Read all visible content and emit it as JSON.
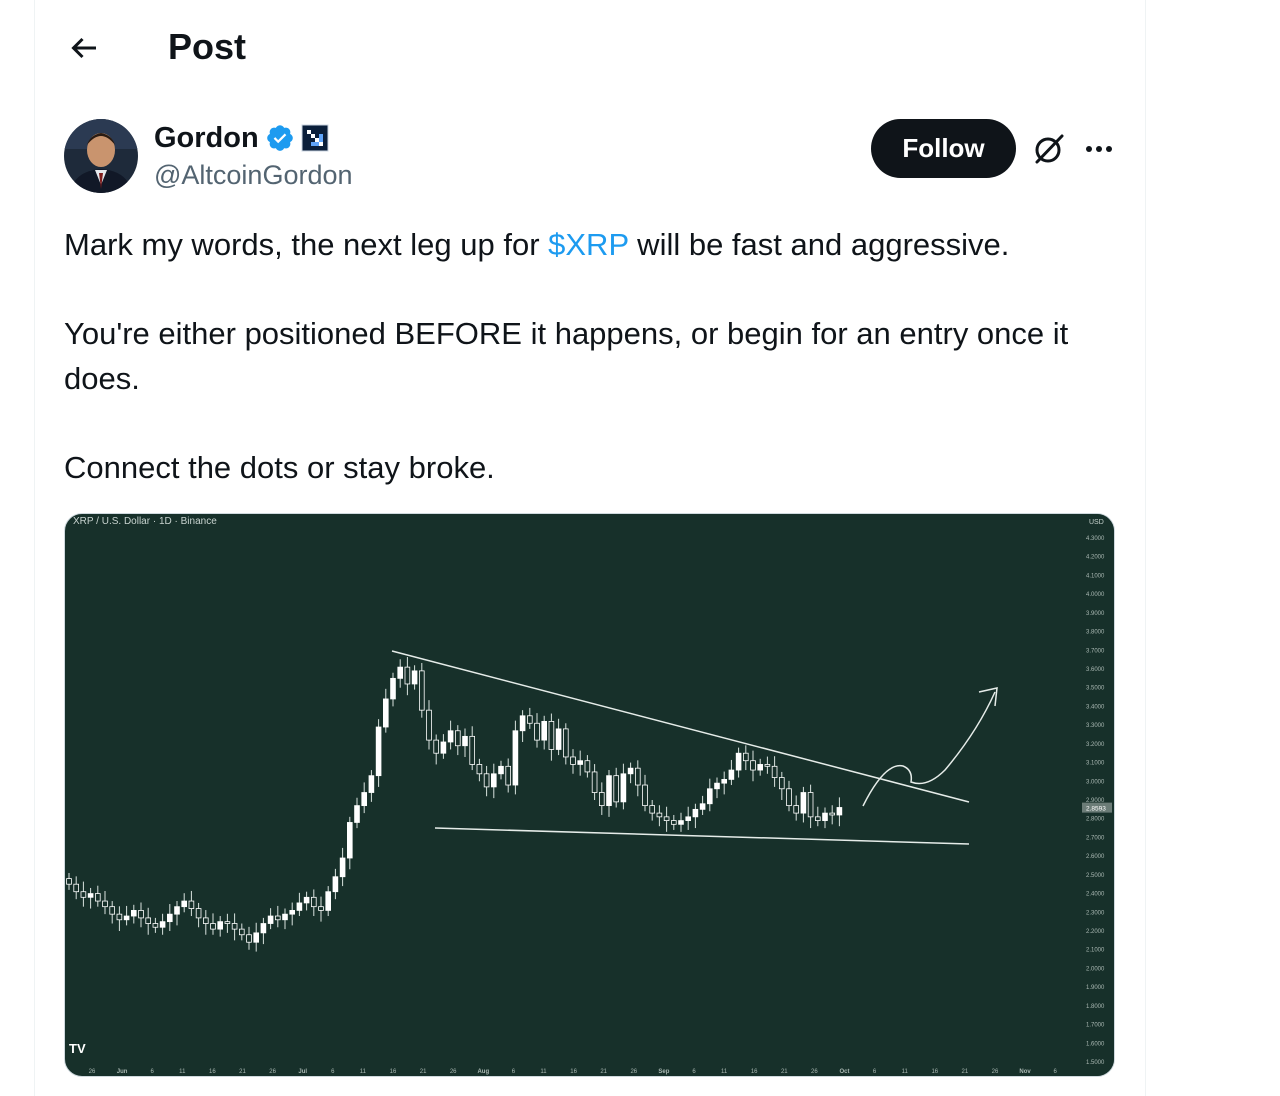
{
  "header": {
    "title": "Post"
  },
  "author": {
    "name": "Gordon",
    "handle": "@AltcoinGordon"
  },
  "actions": {
    "follow_label": "Follow"
  },
  "tweet": {
    "p1_before": "Mark my words, the next leg up for ",
    "p1_link": "$XRP",
    "p1_after": " will be fast and aggressive.",
    "p2": "You're either positioned BEFORE it happens, or begin for an entry once it does.",
    "p3": "Connect the dots or stay broke."
  },
  "colors": {
    "accent": "#1d9bf0",
    "chart_bg": "#17302a",
    "follow_bg": "#0f1419",
    "candle_up": "#ffffff"
  },
  "icons": [
    "back-arrow-icon",
    "verified-badge-icon",
    "affiliate-icon",
    "grok-icon",
    "more-icon"
  ],
  "chart_data": {
    "type": "candlestick",
    "title": "XRP / U.S. Dollar · 1D · Binance",
    "currency_label": "USD",
    "current_price_label": "2.8593",
    "y_ticks": [
      "4.3000",
      "4.2000",
      "4.1000",
      "4.0000",
      "3.9000",
      "3.8000",
      "3.7000",
      "3.6000",
      "3.5000",
      "3.4000",
      "3.3000",
      "3.2000",
      "3.1000",
      "3.0000",
      "2.9000",
      "2.8000",
      "2.7000",
      "2.6000",
      "2.5000",
      "2.4000",
      "2.3000",
      "2.2000",
      "2.1000",
      "2.0000",
      "1.9000",
      "1.8000",
      "1.7000",
      "1.6000",
      "1.5000"
    ],
    "x_ticks": [
      "26",
      "Jun",
      "6",
      "11",
      "16",
      "21",
      "26",
      "Jul",
      "6",
      "11",
      "16",
      "21",
      "26",
      "Aug",
      "6",
      "11",
      "16",
      "21",
      "26",
      "Sep",
      "6",
      "11",
      "16",
      "21",
      "26",
      "Oct",
      "6",
      "11",
      "16",
      "21",
      "26",
      "Nov",
      "6"
    ],
    "ylim": [
      1.5,
      4.3
    ],
    "closes": [
      2.45,
      2.41,
      2.38,
      2.4,
      2.36,
      2.33,
      2.29,
      2.26,
      2.28,
      2.31,
      2.27,
      2.24,
      2.22,
      2.25,
      2.29,
      2.33,
      2.36,
      2.32,
      2.27,
      2.24,
      2.21,
      2.25,
      2.24,
      2.21,
      2.18,
      2.14,
      2.19,
      2.24,
      2.28,
      2.26,
      2.29,
      2.31,
      2.35,
      2.38,
      2.33,
      2.31,
      2.41,
      2.49,
      2.59,
      2.78,
      2.87,
      2.94,
      3.03,
      3.29,
      3.44,
      3.55,
      3.61,
      3.52,
      3.59,
      3.38,
      3.22,
      3.15,
      3.21,
      3.27,
      3.19,
      3.24,
      3.09,
      3.04,
      2.97,
      3.04,
      3.08,
      2.98,
      3.27,
      3.35,
      3.31,
      3.22,
      3.32,
      3.17,
      3.28,
      3.13,
      3.09,
      3.11,
      3.05,
      2.94,
      2.87,
      3.03,
      2.89,
      3.04,
      3.07,
      2.98,
      2.87,
      2.83,
      2.81,
      2.79,
      2.77,
      2.79,
      2.81,
      2.85,
      2.88,
      2.96,
      2.99,
      3.01,
      3.06,
      3.15,
      3.11,
      3.06,
      3.09,
      3.08,
      3.02,
      2.96,
      2.87,
      2.83,
      2.94,
      2.81,
      2.79,
      2.83,
      2.82,
      2.86
    ]
  }
}
